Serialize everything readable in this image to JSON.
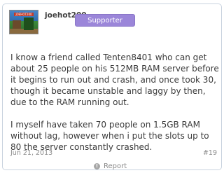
{
  "post": {
    "author": {
      "username": "joehot200",
      "badge": "Supporter",
      "avatar_tag": "JOEHOT200"
    },
    "message": [
      "I know a friend called Tenten8401 who can get about 25 people on his 512MB RAM server before it begins to run out and crash, and once took 30, though it became unstable and laggy by then, due to the RAM running out.",
      "I myself have taken 70 people on 1.5GB RAM without lag, however when i put the slots up to 80 the server constantly crashed."
    ],
    "date": "Jun 21, 2013",
    "post_number": "#19",
    "report_label": "Report",
    "report_icon": "alert-icon"
  }
}
